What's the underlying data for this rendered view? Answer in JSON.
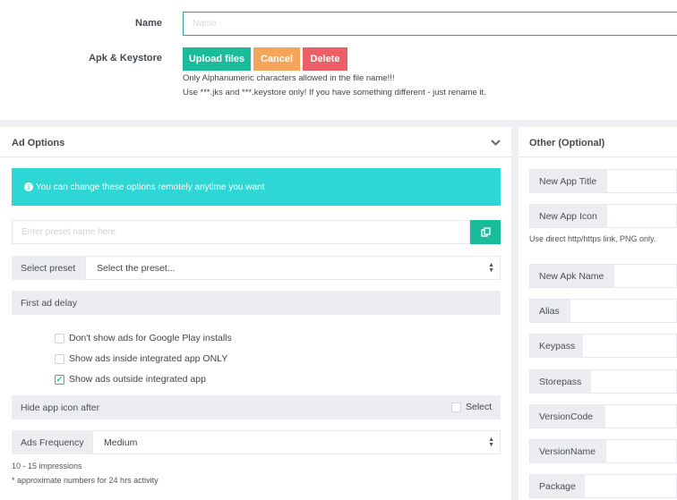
{
  "upload": {
    "name_label": "Name",
    "name_placeholder": "Name",
    "apk_label": "Apk & Keystore",
    "upload_btn": "Upload files",
    "cancel_btn": "Cancel",
    "delete_btn": "Delete",
    "note1": "Only Alphanumeric characters allowed in the file name!!!",
    "note2": "Use ***.jks and ***.keystore only! If you have something different - just rename it."
  },
  "ad_options": {
    "title": "Ad Options",
    "alert": "You can change these options remotely anytime you want",
    "preset_placeholder": "Enter preset name here",
    "select_preset_label": "Select preset",
    "select_preset_value": "Select the preset...",
    "first_ad_delay_label": "First ad delay",
    "checks": [
      {
        "label": "Don't show ads for Google Play installs",
        "checked": false
      },
      {
        "label": "Show ads inside integrated app ONLY",
        "checked": false
      },
      {
        "label": "Show ads outside integrated app",
        "checked": true
      }
    ],
    "hide_icon_label": "Hide app icon after",
    "hide_icon_select": "Select",
    "freq_label": "Ads Frequency",
    "freq_value": "Medium",
    "impressions": "10 - 15 impressions",
    "approx": "* approximate numbers for 24 hrs activity"
  },
  "other": {
    "title": "Other (Optional)",
    "new_app_title": "New App Title",
    "new_app_icon": "New App Icon",
    "icon_hint": "Use direct http/https link, PNG only.",
    "new_apk_name": "New Apk Name",
    "alias": "Alias",
    "keypass": "Keypass",
    "storepass": "Storepass",
    "version_code": "VersionCode",
    "version_name": "VersionName",
    "package": "Package"
  },
  "colors": {
    "accent": "#1abc9c",
    "info": "#2fd6d6",
    "warning": "#f5a55a",
    "danger": "#ec5f67"
  }
}
